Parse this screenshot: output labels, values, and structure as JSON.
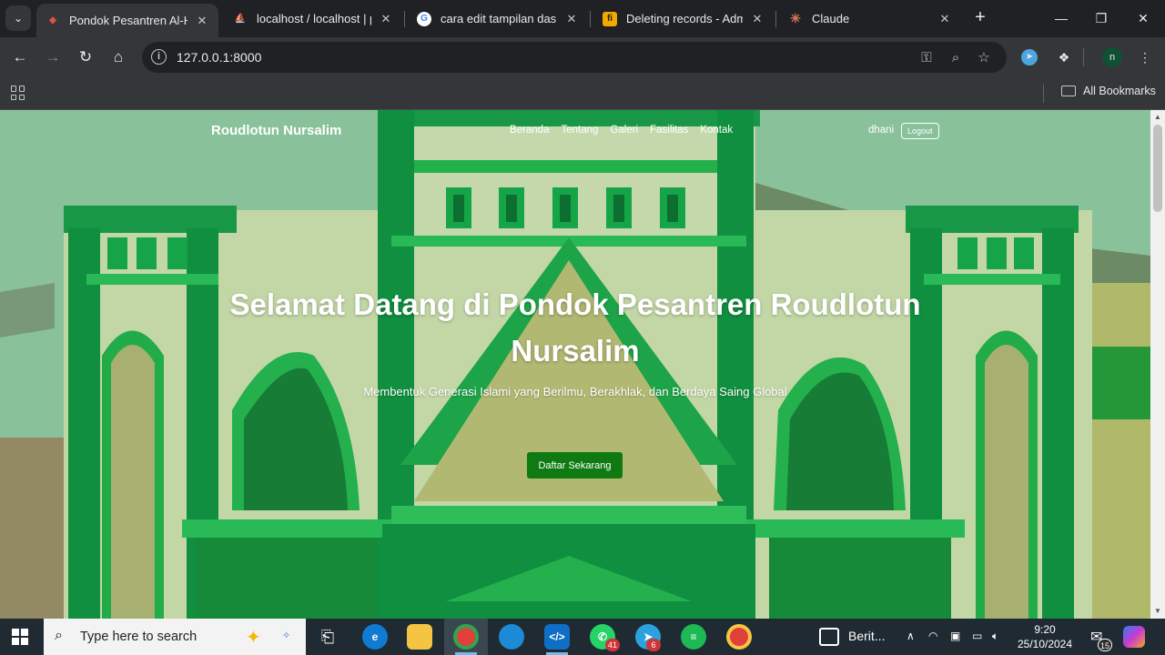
{
  "browser": {
    "tab_menu_icon": "chevron-down-icon",
    "tabs": [
      {
        "title": "Pondok Pesantren Al-Hikm",
        "favicon": "laravel-icon",
        "active": true
      },
      {
        "title": "localhost / localhost | php",
        "favicon": "phpmyadmin-icon",
        "active": false
      },
      {
        "title": "cara edit tampilan dashb",
        "favicon": "google-icon",
        "active": false
      },
      {
        "title": "Deleting records - Admin",
        "favicon": "filament-icon",
        "active": false
      },
      {
        "title": "Claude",
        "favicon": "claude-icon",
        "active": false
      }
    ],
    "url": "127.0.0.1:8000",
    "bookmarks_label": "All Bookmarks",
    "profile_initial": "n"
  },
  "site": {
    "brand": "Roudlotun Nursalim",
    "nav": [
      "Beranda",
      "Tentang",
      "Galeri",
      "Fasilitas",
      "Kontak"
    ],
    "user": "dhani",
    "logout_label": "Logout",
    "hero_title": "Selamat Datang di Pondok Pesantren Roudlotun Nursalim",
    "hero_subtitle": "Membentuk Generasi Islami yang Berilmu, Berakhlak, dan Berdaya Saing Global",
    "cta_label": "Daftar Sekarang",
    "colors": {
      "green_dark": "#0b8a3a",
      "green_light": "#2ecc55",
      "wall": "#e2e3b8",
      "cta": "#0f7a12"
    }
  },
  "taskbar": {
    "search_placeholder": "Type here to search",
    "whatsapp_badge": "41",
    "telegram_badge": "6",
    "news_label": "Berit...",
    "time": "9:20",
    "date": "25/10/2024",
    "notification_count": "15"
  }
}
